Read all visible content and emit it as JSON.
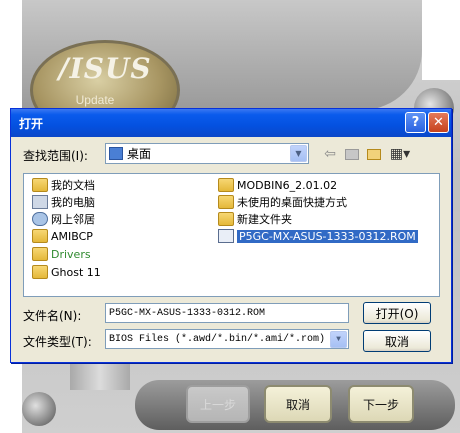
{
  "app": {
    "logo_text": "/ISUS",
    "logo_sub": "Update",
    "buttons": {
      "back": "上一步",
      "cancel": "取消",
      "next": "下一步"
    }
  },
  "dialog": {
    "title": "打开",
    "help_glyph": "?",
    "close_glyph": "✕",
    "lookin_label": "查找范围(I):",
    "lookin_value": "桌面",
    "files_left": [
      {
        "name": "我的文档",
        "type": "doc-folder"
      },
      {
        "name": "我的电脑",
        "type": "computer"
      },
      {
        "name": "网上邻居",
        "type": "network"
      },
      {
        "name": "AMIBCP",
        "type": "folder"
      },
      {
        "name": "Drivers",
        "type": "folder"
      },
      {
        "name": "Ghost 11",
        "type": "folder"
      }
    ],
    "files_right": [
      {
        "name": "MODBIN6_2.01.02",
        "type": "folder"
      },
      {
        "name": "未使用的桌面快捷方式",
        "type": "folder"
      },
      {
        "name": "新建文件夹",
        "type": "folder"
      },
      {
        "name": "P5GC-MX-ASUS-1333-0312.ROM",
        "type": "rom"
      }
    ],
    "filename_label": "文件名(N):",
    "filename_value": "P5GC-MX-ASUS-1333-0312.ROM",
    "filetype_label": "文件类型(T):",
    "filetype_value": "BIOS Files (*.awd/*.bin/*.ami/*.rom)",
    "open_button": "打开(O)",
    "cancel_button": "取消"
  }
}
